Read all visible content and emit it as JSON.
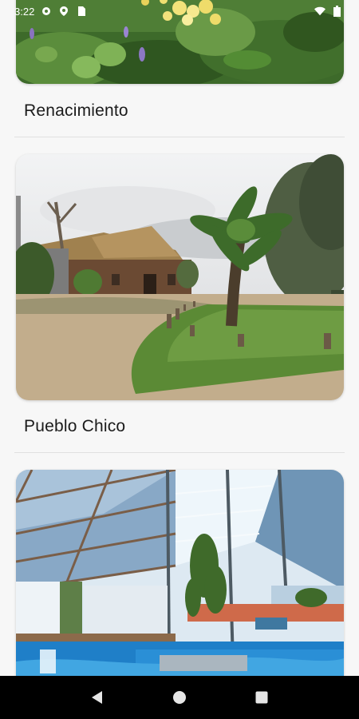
{
  "status_bar": {
    "time": "3:22",
    "icons": [
      "settings-gear-icon",
      "location-icon",
      "sim-card-icon",
      "wifi-icon",
      "battery-icon"
    ]
  },
  "places": [
    {
      "name": "Renacimiento",
      "image": "garden-flowers-photo"
    },
    {
      "name": "Pueblo Chico",
      "image": "thatched-house-palm-photo"
    },
    {
      "name": "",
      "image": "indoor-pool-photo"
    }
  ],
  "navigation": {
    "back": "back-triangle-icon",
    "home": "home-circle-icon",
    "recents": "recents-square-icon"
  },
  "colors": {
    "background": "#f7f7f7",
    "title_text": "#1b1b1b",
    "divider": "#e1e1e1",
    "nav_bar": "#000000"
  }
}
